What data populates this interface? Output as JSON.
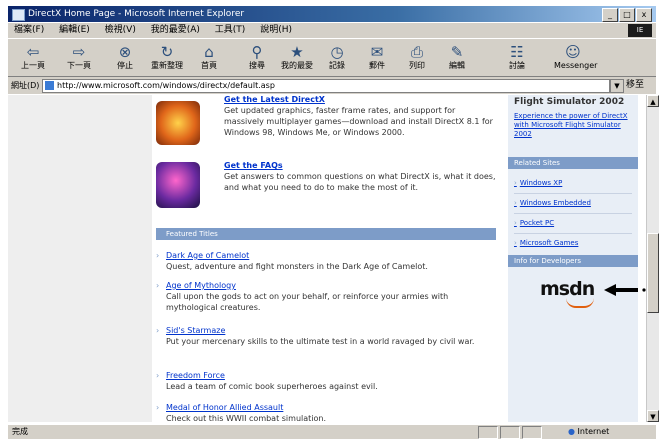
{
  "window": {
    "title": "DirectX Home Page - Microsoft Internet Explorer",
    "controls": [
      "_",
      "□",
      "x"
    ]
  },
  "menu": {
    "items": [
      "檔案(F)",
      "編輯(E)",
      "檢視(V)",
      "我的最愛(A)",
      "工具(T)",
      "說明(H)"
    ],
    "logo": "IE"
  },
  "toolbar": {
    "buttons": [
      {
        "icon": "back-arrow-icon",
        "label": "上一頁"
      },
      {
        "icon": "forward-arrow-icon",
        "label": "下一頁"
      },
      {
        "icon": "stop-icon",
        "label": "停止"
      },
      {
        "icon": "refresh-icon",
        "label": "重新整理"
      },
      {
        "icon": "home-icon",
        "label": "首頁"
      },
      {
        "icon": "search-icon",
        "label": "搜尋"
      },
      {
        "icon": "favorites-icon",
        "label": "我的最愛"
      },
      {
        "icon": "history-icon",
        "label": "記錄"
      },
      {
        "icon": "mail-icon",
        "label": "郵件"
      },
      {
        "icon": "print-icon",
        "label": "列印"
      },
      {
        "icon": "edit-icon",
        "label": "編輯"
      },
      {
        "icon": "discuss-icon",
        "label": "討論"
      },
      {
        "icon": "messenger-icon",
        "label": "Messenger"
      }
    ]
  },
  "address": {
    "label": "網址(D)",
    "url": "http://www.microsoft.com/windows/directx/default.asp",
    "go": "移至"
  },
  "main": {
    "features": [
      {
        "link": "Get the Latest DirectX",
        "text": "Get updated graphics, faster frame rates, and support for massively multiplayer games—download and install DirectX 8.1 for Windows 98, Windows Me, or Windows 2000."
      },
      {
        "link": "Get the FAQs",
        "text": "Get answers to common questions on what DirectX is, what it does, and what you need to do to make the most of it."
      }
    ],
    "featured_titles_heading": "Featured Titles",
    "titles": [
      {
        "link": "Dark Age of Camelot",
        "text": "Quest, adventure and fight monsters in the Dark Age of Camelot."
      },
      {
        "link": "Age of Mythology",
        "text": "Call upon the gods to act on your behalf, or reinforce your armies with mythological creatures."
      },
      {
        "link": "Sid's Starmaze",
        "text": "Put your mercenary skills to the ultimate test in a world ravaged by civil war."
      },
      {
        "link": "Freedom Force",
        "text": "Lead a team of comic book superheroes against evil."
      },
      {
        "link": "Medal of Honor Allied Assault",
        "text": "Check out this WWII combat simulation."
      }
    ]
  },
  "right": {
    "heading": "Flight Simulator 2002",
    "promo": "Experience the power of DirectX with Microsoft Flight Simulator 2002",
    "related_heading": "Related Sites",
    "related": [
      "Windows XP",
      "Windows Embedded",
      "Pocket PC",
      "Microsoft Games"
    ],
    "dev_heading": "Info for Developers",
    "msdn": "msdn"
  },
  "status": {
    "text": "完成",
    "zone": "Internet"
  },
  "colors": {
    "accent": "#7d9cc8",
    "link": "#0033cc",
    "title_bar": "#0a246a"
  }
}
